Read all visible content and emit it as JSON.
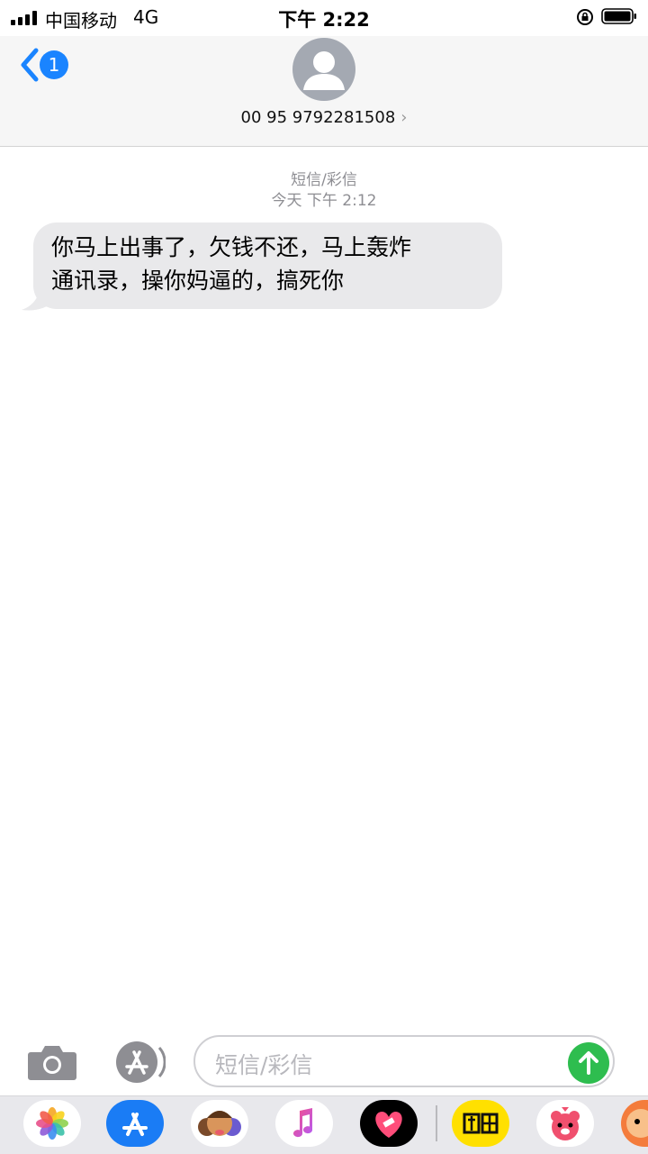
{
  "status_bar": {
    "carrier": "中国移动",
    "network": "4G",
    "time": "下午 2:22"
  },
  "nav": {
    "back_badge": "1",
    "contact_number": "00 95 9792281508",
    "contact_chevron": "›"
  },
  "conversation": {
    "kind_label": "短信/彩信",
    "timestamp": "今天 下午 2:12",
    "messages": [
      {
        "direction": "incoming",
        "text_line1": "你马上出事了，欠钱不还，马上轰炸",
        "text_line2": "通讯录，操你妈逼的，搞死你"
      }
    ]
  },
  "composer": {
    "placeholder": "短信/彩信"
  },
  "app_drawer": {
    "apps": [
      {
        "name": "photos-app-icon"
      },
      {
        "name": "appstore-app-icon"
      },
      {
        "name": "memoji-app-icon"
      },
      {
        "name": "music-app-icon"
      },
      {
        "name": "heart-sticker-app-icon"
      },
      {
        "name": "xianyu-app-icon",
        "label": "闲鱼"
      },
      {
        "name": "bear-sticker-app-icon"
      },
      {
        "name": "cartoon-sticker-app-icon"
      }
    ]
  },
  "colors": {
    "accent_blue": "#1a84ff",
    "send_green": "#2ebd4f",
    "bubble_gray": "#e9e9eb"
  }
}
